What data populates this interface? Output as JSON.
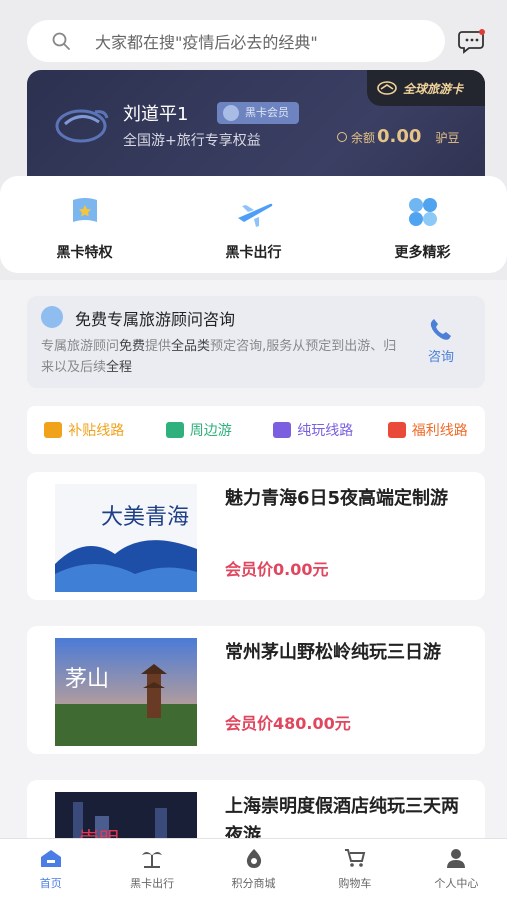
{
  "search": {
    "placeholder": "大家都在搜\"疫情后必去的经典\""
  },
  "member_card": {
    "badge": "全球旅游卡",
    "name": "刘道平1",
    "tag": "黑卡会员",
    "subtitle": "全国游+旅行专享权益",
    "balance_label": "余额",
    "balance_value": "0.00",
    "balance_unit": "驴豆"
  },
  "quick_actions": [
    {
      "label": "黑卡特权",
      "icon": "flag-icon"
    },
    {
      "label": "黑卡出行",
      "icon": "airplane-icon"
    },
    {
      "label": "更多精彩",
      "icon": "grid-icon"
    }
  ],
  "consult": {
    "title": "免费专属旅游顾问咨询",
    "desc_pre": "专属旅游顾问",
    "desc_b1": "免费",
    "desc_mid": "提供",
    "desc_b2": "全品类",
    "desc_post": "预定咨询,服务从预定到出游、归来以及后续",
    "desc_b3": "全程",
    "button": "咨询"
  },
  "categories": [
    {
      "label": "补贴线路",
      "color": "#f0a21b"
    },
    {
      "label": "周边游",
      "color": "#2fb07c"
    },
    {
      "label": "纯玩线路",
      "color": "#7b5fe0"
    },
    {
      "label": "福利线路",
      "color": "#f06b2a"
    }
  ],
  "products": [
    {
      "title": "魅力青海6日5夜高端定制游",
      "price": "会员价0.00元",
      "image_text": "大美青海"
    },
    {
      "title": "常州茅山野松岭纯玩三日游",
      "price": "会员价480.00元",
      "image_text": "茅山"
    },
    {
      "title": "上海崇明度假酒店纯玩三天两夜游",
      "price": "",
      "image_text": "崇明"
    }
  ],
  "tabbar": [
    {
      "label": "首页",
      "icon": "home-icon",
      "active": true
    },
    {
      "label": "黑卡出行",
      "icon": "palm-tree-icon",
      "active": false
    },
    {
      "label": "积分商城",
      "icon": "bag-icon",
      "active": false
    },
    {
      "label": "购物车",
      "icon": "cart-icon",
      "active": false
    },
    {
      "label": "个人中心",
      "icon": "person-icon",
      "active": false
    }
  ]
}
